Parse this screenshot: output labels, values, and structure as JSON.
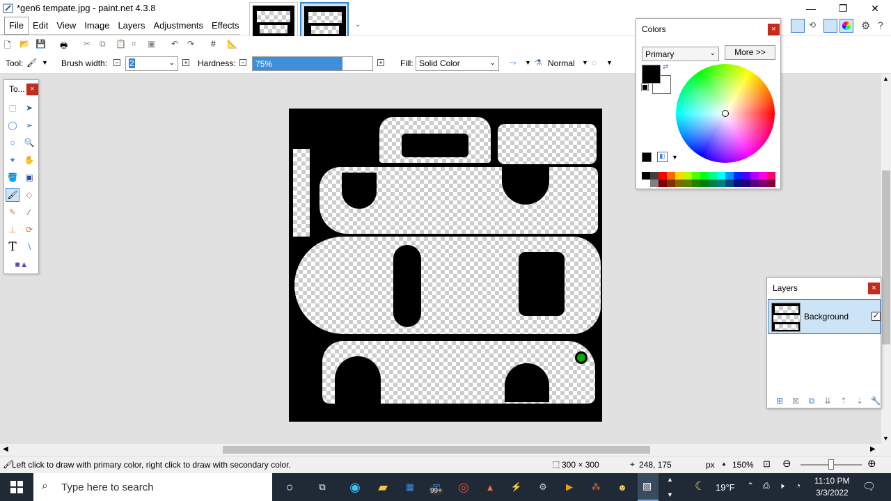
{
  "window": {
    "title": "*gen6 tempate.jpg - paint.net 4.3.8"
  },
  "menu": {
    "items": [
      "File",
      "Edit",
      "View",
      "Image",
      "Layers",
      "Adjustments",
      "Effects"
    ]
  },
  "toolbar": {
    "tool_label": "Tool:",
    "brush_width_label": "Brush width:",
    "brush_width_value": "2",
    "hardness_label": "Hardness:",
    "hardness_value": "75%",
    "hardness_fraction": 0.75,
    "fill_label": "Fill:",
    "fill_value": "Solid Color",
    "blend_mode": "Normal"
  },
  "tools_window": {
    "title": "To..."
  },
  "colors_window": {
    "title": "Colors",
    "mode_select": "Primary",
    "more_button": "More >>",
    "primary_color": "#000000",
    "secondary_color": "#ffffff"
  },
  "layers_window": {
    "title": "Layers",
    "layers": [
      {
        "name": "Background",
        "visible": true
      }
    ]
  },
  "status": {
    "hint": "Left click to draw with primary color, right click to draw with secondary color.",
    "image_size": "300 × 300",
    "cursor_pos": "248, 175",
    "units": "px",
    "zoom": "150%"
  },
  "taskbar": {
    "search_placeholder": "Type here to search",
    "badge": "99+",
    "weather": "19°F",
    "time": "11:10 PM",
    "date": "3/3/2022"
  },
  "colors": {
    "accent": "#3b7fd6",
    "selection_bg": "#cde4f7",
    "close_red": "#c42b1c",
    "taskbar_bg": "#1f2a36"
  }
}
